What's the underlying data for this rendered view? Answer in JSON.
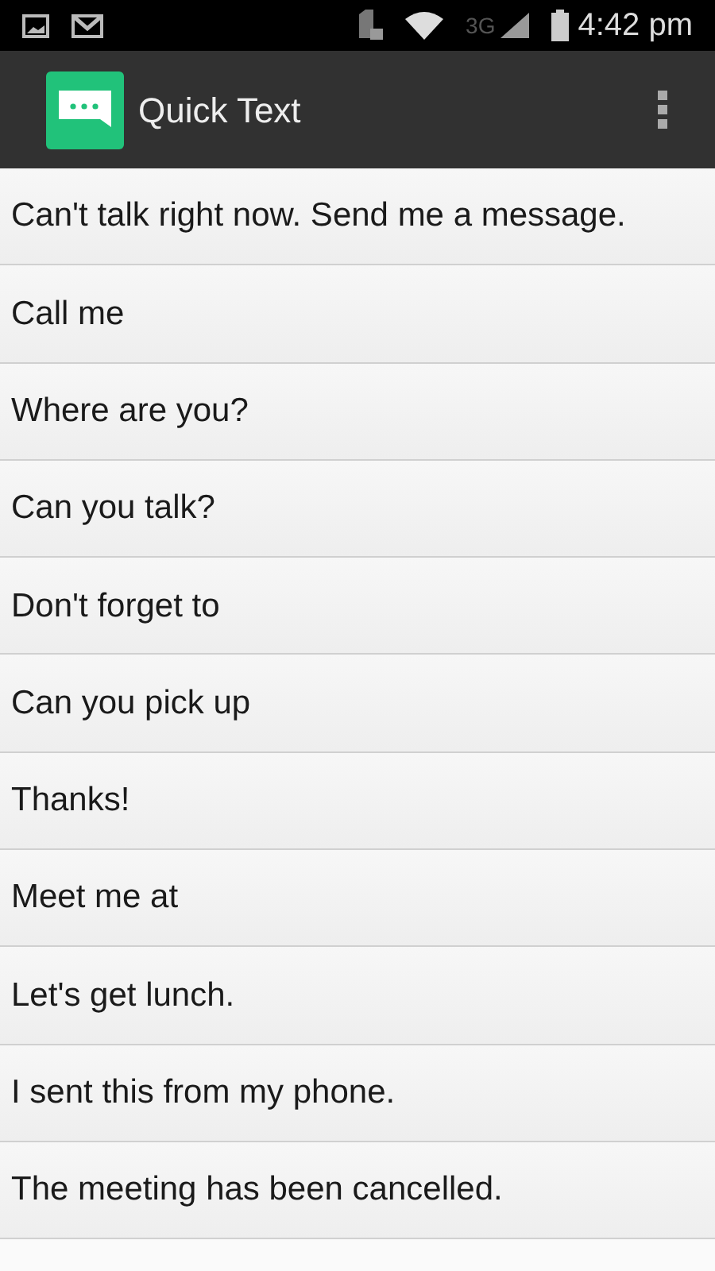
{
  "status_bar": {
    "network": "3G",
    "time": "4:42 pm"
  },
  "app_bar": {
    "title": "Quick Text"
  },
  "messages": [
    "Can't talk right now. Send me a message.",
    "Call me",
    "Where are you?",
    "Can you talk?",
    "Don't forget to",
    "Can you pick up",
    "Thanks!",
    "Meet me at",
    "Let's get lunch.",
    "I sent this from my phone.",
    "The meeting has been cancelled."
  ]
}
